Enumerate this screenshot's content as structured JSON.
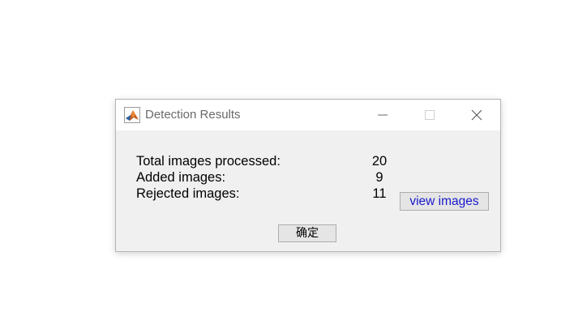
{
  "window": {
    "title": "Detection Results",
    "app_icon": "matlab-logo-icon",
    "controls": [
      "minimize-icon",
      "maximize-icon",
      "close-icon"
    ]
  },
  "results": {
    "rows": [
      {
        "label": "Total images processed:",
        "value": "20"
      },
      {
        "label": "Added images:",
        "value": "9"
      },
      {
        "label": "Rejected images:",
        "value": "11"
      }
    ]
  },
  "buttons": {
    "view_images": "view images",
    "ok": "确定"
  },
  "colors": {
    "view_images_text": "#1a1acc",
    "dialog_background": "#f0f0f0"
  }
}
